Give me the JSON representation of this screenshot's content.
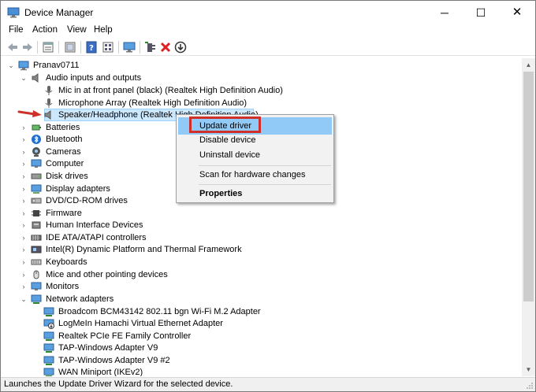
{
  "window": {
    "title": "Device Manager",
    "controls": {
      "minimize": "─",
      "maximize": "☐",
      "close": "✕"
    }
  },
  "menu": [
    "File",
    "Action",
    "View",
    "Help"
  ],
  "toolbar": [
    "back-icon",
    "forward-icon",
    "properties-sheet-icon",
    "show-hide-icon",
    "help-icon",
    "view-icon",
    "monitor-icon",
    "add-driver-icon",
    "uninstall-icon",
    "download-icon"
  ],
  "tree": {
    "root": "Pranav0711",
    "audio_category": "Audio inputs and outputs",
    "audio_children": [
      "Mic in at front panel (black) (Realtek High Definition Audio)",
      "Microphone Array (Realtek High Definition Audio)",
      "Speaker/Headphone (Realtek High Definition Audio)"
    ],
    "categories": [
      "Batteries",
      "Bluetooth",
      "Cameras",
      "Computer",
      "Disk drives",
      "Display adapters",
      "DVD/CD-ROM drives",
      "Firmware",
      "Human Interface Devices",
      "IDE ATA/ATAPI controllers",
      "Intel(R) Dynamic Platform and Thermal Framework",
      "Keyboards",
      "Mice and other pointing devices",
      "Monitors"
    ],
    "network_category": "Network adapters",
    "network_children": [
      "Broadcom BCM43142 802.11 bgn Wi-Fi M.2 Adapter",
      "LogMeIn Hamachi Virtual Ethernet Adapter",
      "Realtek PCIe FE Family Controller",
      "TAP-Windows Adapter V9",
      "TAP-Windows Adapter V9 #2",
      "WAN Miniport (IKEv2)"
    ]
  },
  "context_menu": {
    "update_driver": "Update driver",
    "disable_device": "Disable device",
    "uninstall_device": "Uninstall device",
    "scan_hardware": "Scan for hardware changes",
    "properties": "Properties"
  },
  "status_bar": "Launches the Update Driver Wizard for the selected device.",
  "colors": {
    "selection": "#cce8ff",
    "menu_highlight": "#91c9f7",
    "annotation_red": "#d0302a"
  }
}
